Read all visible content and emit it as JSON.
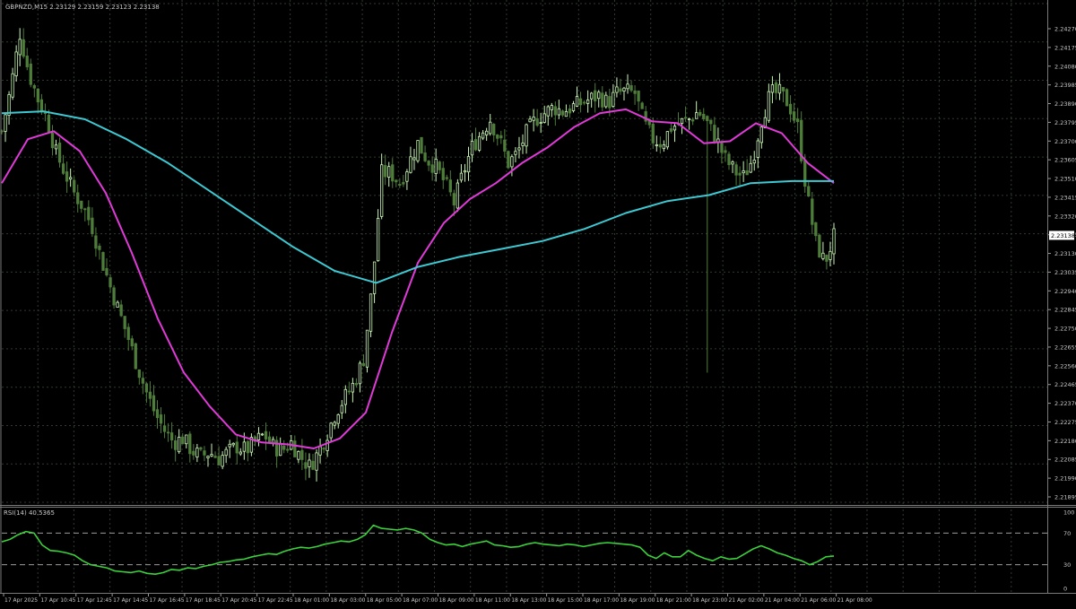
{
  "header": {
    "symbol_info": "GBPNZD,M15  2.23129 2.23159 2.23123 2.23138"
  },
  "rsi_panel": {
    "label": "RSI(14) 40.5365"
  },
  "colors": {
    "background": "#000000",
    "grid": "#2f3a2f",
    "candle_bull_fill": "#000000",
    "candle_bull_outline": "#c8f5b4",
    "candle_bear_fill": "#4e7d3a",
    "candle_bear_outline": "#4e7d3a",
    "fast_ma": "#e03ad8",
    "slow_ma": "#3ec8d2",
    "rsi_line": "#3bd13b",
    "text": "#c8c8c8",
    "price_tag_bg": "#ffffff"
  },
  "chart_data": [
    {
      "type": "candlestick",
      "title": "GBPNZD,M15",
      "ylim": [
        2.218,
        2.243
      ],
      "y_ticks": [
        "2.24270",
        "2.24175",
        "2.24080",
        "2.23985",
        "2.23890",
        "2.23795",
        "2.23700",
        "2.23605",
        "2.23510",
        "2.23415",
        "2.23320",
        "2.23225",
        "2.23130",
        "2.23035",
        "2.22940",
        "2.22845",
        "2.22750",
        "2.22655",
        "2.22560",
        "2.22465",
        "2.22370",
        "2.22275",
        "2.22180",
        "2.22085",
        "2.21990",
        "2.21895"
      ],
      "x_ticks": [
        "17 Apr 2025",
        "17 Apr 10:45",
        "17 Apr 12:45",
        "17 Apr 14:45",
        "17 Apr 16:45",
        "17 Apr 18:45",
        "17 Apr 20:45",
        "17 Apr 22:45",
        "18 Apr 01:00",
        "18 Apr 03:00",
        "18 Apr 05:00",
        "18 Apr 07:00",
        "18 Apr 09:00",
        "18 Apr 11:00",
        "18 Apr 13:00",
        "18 Apr 15:00",
        "18 Apr 17:00",
        "18 Apr 19:00",
        "18 Apr 21:00",
        "18 Apr 23:00",
        "21 Apr 02:00",
        "21 Apr 04:00",
        "21 Apr 06:00",
        "21 Apr 08:00"
      ],
      "current_price": "2.23138",
      "close_path": [
        [
          0,
          2.2366
        ],
        [
          5,
          2.2388
        ],
        [
          10,
          2.2415
        ],
        [
          15,
          2.2395
        ],
        [
          20,
          2.2382
        ],
        [
          25,
          2.2372
        ],
        [
          30,
          2.2355
        ],
        [
          35,
          2.2345
        ],
        [
          40,
          2.2335
        ],
        [
          45,
          2.2328
        ],
        [
          50,
          2.2318
        ],
        [
          55,
          2.2302
        ],
        [
          60,
          2.2288
        ],
        [
          65,
          2.2275
        ],
        [
          70,
          2.2262
        ],
        [
          75,
          2.2248
        ],
        [
          80,
          2.2235
        ],
        [
          85,
          2.2224
        ],
        [
          90,
          2.2216
        ],
        [
          95,
          2.221
        ],
        [
          100,
          2.2212
        ],
        [
          105,
          2.2206
        ],
        [
          110,
          2.2203
        ],
        [
          115,
          2.2205
        ],
        [
          120,
          2.2202
        ],
        [
          125,
          2.2205
        ],
        [
          130,
          2.2208
        ],
        [
          135,
          2.2206
        ],
        [
          140,
          2.221
        ],
        [
          145,
          2.2214
        ],
        [
          150,
          2.2208
        ],
        [
          155,
          2.2206
        ],
        [
          160,
          2.221
        ],
        [
          165,
          2.2203
        ],
        [
          170,
          2.2198
        ],
        [
          175,
          2.2205
        ],
        [
          180,
          2.2215
        ],
        [
          185,
          2.2226
        ],
        [
          190,
          2.2233
        ],
        [
          195,
          2.224
        ],
        [
          200,
          2.2252
        ],
        [
          205,
          2.229
        ],
        [
          210,
          2.2345
        ],
        [
          215,
          2.2345
        ],
        [
          220,
          2.234
        ],
        [
          225,
          2.235
        ],
        [
          230,
          2.236
        ],
        [
          235,
          2.2352
        ],
        [
          240,
          2.2348
        ],
        [
          245,
          2.234
        ],
        [
          250,
          2.233
        ],
        [
          255,
          2.2345
        ],
        [
          260,
          2.2358
        ],
        [
          265,
          2.2365
        ],
        [
          270,
          2.2372
        ],
        [
          275,
          2.2362
        ],
        [
          280,
          2.235
        ],
        [
          285,
          2.2355
        ],
        [
          290,
          2.2365
        ],
        [
          295,
          2.2372
        ],
        [
          300,
          2.2375
        ],
        [
          305,
          2.2378
        ],
        [
          310,
          2.2376
        ],
        [
          315,
          2.2378
        ],
        [
          320,
          2.238
        ],
        [
          325,
          2.2382
        ],
        [
          330,
          2.2384
        ],
        [
          335,
          2.238
        ],
        [
          340,
          2.2385
        ],
        [
          345,
          2.2386
        ],
        [
          350,
          2.2385
        ],
        [
          355,
          2.237
        ],
        [
          360,
          2.2362
        ],
        [
          365,
          2.236
        ],
        [
          370,
          2.2368
        ],
        [
          375,
          2.237
        ],
        [
          380,
          2.2372
        ],
        [
          385,
          2.2376
        ],
        [
          390,
          2.237
        ],
        [
          395,
          2.2362
        ],
        [
          400,
          2.2352
        ],
        [
          405,
          2.2346
        ],
        [
          410,
          2.2343
        ],
        [
          415,
          2.2352
        ],
        [
          420,
          2.2372
        ],
        [
          425,
          2.2385
        ],
        [
          430,
          2.2385
        ],
        [
          435,
          2.238
        ],
        [
          440,
          2.2368
        ],
        [
          445,
          2.2335
        ],
        [
          450,
          2.231
        ],
        [
          455,
          2.23
        ],
        [
          460,
          2.2313
        ]
      ],
      "events": [
        {
          "label": "low spike",
          "slot": 390,
          "low": 2.2245
        }
      ],
      "series": [
        {
          "name": "fast_ma",
          "values": [
            2.234,
            2.2362,
            2.2366,
            2.2356,
            2.2335,
            2.2305,
            2.2272,
            2.2245,
            2.2228,
            2.2214,
            2.221,
            2.2209,
            2.2207,
            2.2212,
            2.2225,
            2.2265,
            2.23,
            2.232,
            2.2332,
            2.234,
            2.235,
            2.2358,
            2.2368,
            2.2375,
            2.2377,
            2.2371,
            2.237,
            2.236,
            2.2361,
            2.237,
            2.2365,
            2.235,
            2.234
          ]
        },
        {
          "name": "slow_ma",
          "values": [
            2.2375,
            2.2376,
            2.2372,
            2.2362,
            2.235,
            2.2336,
            2.2322,
            2.2308,
            2.2296,
            2.229,
            2.2298,
            2.2303,
            2.2307,
            2.2311,
            2.2317,
            2.2325,
            2.2331,
            2.2334,
            2.234,
            2.2341,
            2.2341
          ]
        }
      ]
    },
    {
      "type": "line",
      "title": "RSI(14)",
      "ylim": [
        0,
        100
      ],
      "y_ticks": [
        "100",
        "70",
        "30",
        "0"
      ],
      "levels": [
        70,
        30
      ],
      "values": [
        59,
        62,
        68,
        72,
        70,
        55,
        48,
        47,
        45,
        42,
        35,
        30,
        28,
        26,
        22,
        21,
        20,
        22,
        19,
        18,
        20,
        24,
        23,
        26,
        25,
        28,
        30,
        33,
        34,
        36,
        37,
        40,
        42,
        44,
        43,
        47,
        50,
        52,
        51,
        53,
        56,
        58,
        60,
        59,
        62,
        68,
        80,
        76,
        75,
        74,
        76,
        74,
        70,
        62,
        58,
        55,
        56,
        53,
        56,
        58,
        60,
        55,
        54,
        52,
        53,
        56,
        58,
        56,
        55,
        54,
        56,
        55,
        53,
        55,
        57,
        58,
        57,
        56,
        55,
        52,
        42,
        38,
        45,
        40,
        40,
        48,
        42,
        38,
        35,
        40,
        37,
        38,
        44,
        50,
        54,
        50,
        45,
        42,
        38,
        35,
        30,
        34,
        40,
        41
      ]
    }
  ]
}
